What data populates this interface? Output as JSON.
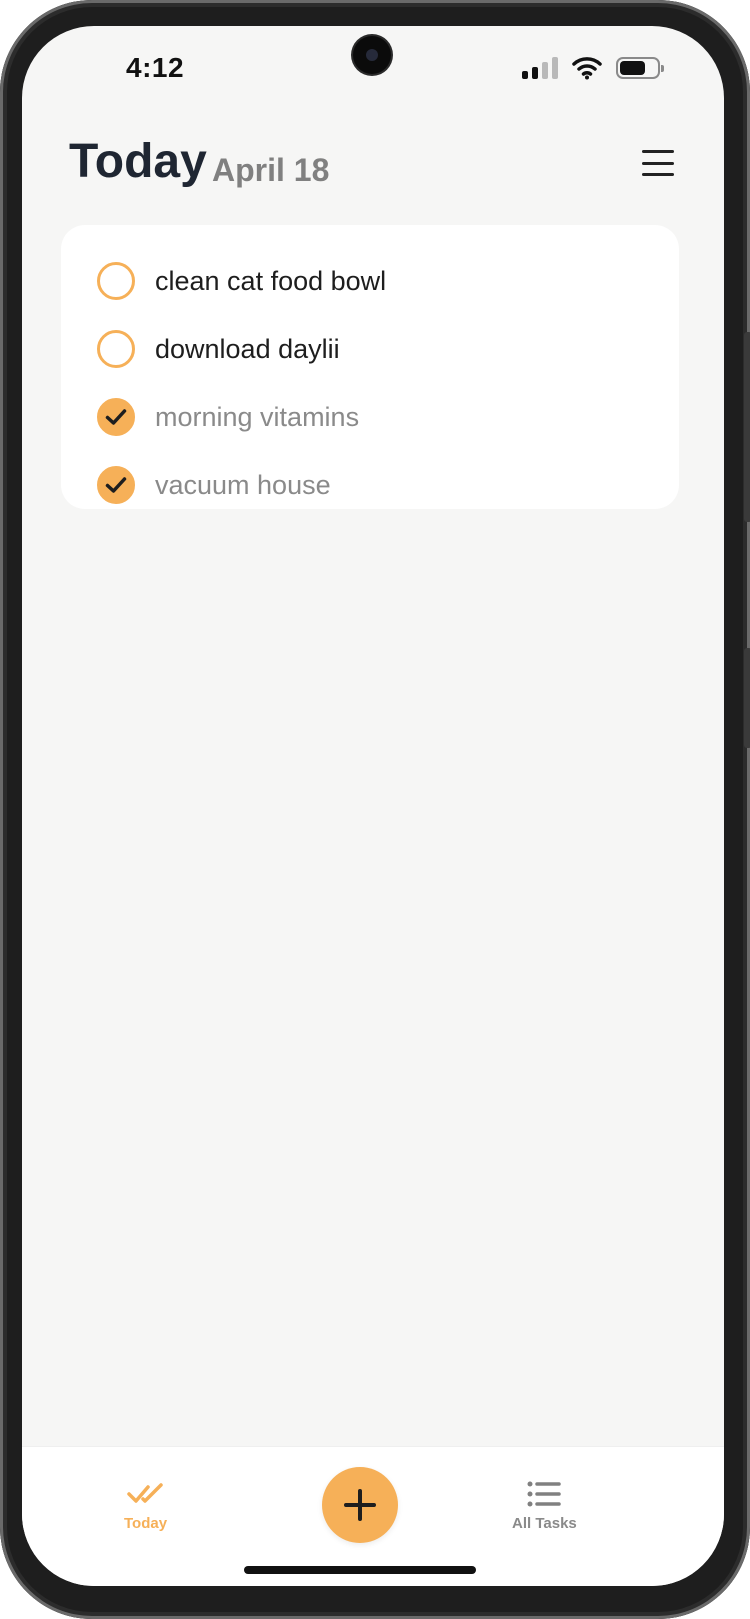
{
  "status_bar": {
    "time": "4:12"
  },
  "header": {
    "title": "Today",
    "date": "April 18"
  },
  "tasks": [
    {
      "label": "clean cat food bowl",
      "done": false
    },
    {
      "label": "download daylii",
      "done": false
    },
    {
      "label": "morning vitamins",
      "done": true
    },
    {
      "label": "vacuum house",
      "done": true
    }
  ],
  "bottom_nav": {
    "today_label": "Today",
    "all_tasks_label": "All Tasks"
  },
  "icons": {
    "menu": "hamburger-menu-icon",
    "check": "checkmark-icon",
    "add": "plus-icon",
    "today": "double-check-icon",
    "all_tasks": "list-icon"
  },
  "colors": {
    "accent": "#f6b058",
    "title": "#1f2632",
    "muted": "#8a8a8a",
    "background": "#f6f6f5"
  }
}
